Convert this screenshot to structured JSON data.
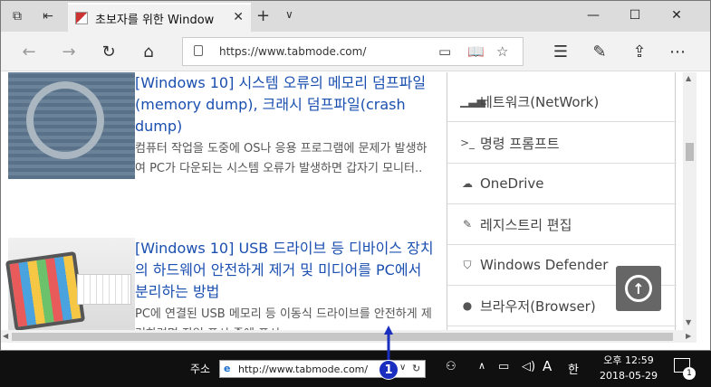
{
  "browser": {
    "tab_title": "초보자를 위한 Window",
    "url": "https://www.tabmode.com/"
  },
  "articles": [
    {
      "title": "[Windows 10] 시스템 오류의 메모리 덤프파일(memory dump), 크래시 덤프파일(crash dump)",
      "excerpt": "컴퓨터 작업을 도중에 OS나 응용 프로그램에 문제가 발생하여 PC가 다운되는 시스템 오류가 발생하면 갑자기 모니터.."
    },
    {
      "title": "[Windows 10] USB 드라이브 등 디바이스 장치의 하드웨어 안전하게 제거 및 미디어를 PC에서 분리하는 방법",
      "excerpt": "PC에 연결된 USB 메모리 등 이동식 드라이브를 안전하게 제거하려면 작업 표시 줄에 표시..."
    }
  ],
  "sidebar": {
    "items": [
      {
        "label": "네트워크(NetWork)",
        "icon": "signal-icon"
      },
      {
        "label": "명령 프롬프트",
        "icon": "terminal-icon"
      },
      {
        "label": "OneDrive",
        "icon": "cloud-icon"
      },
      {
        "label": "레지스트리 편집",
        "icon": "edit-icon"
      },
      {
        "label": "Windows Defender",
        "icon": "shield-icon"
      },
      {
        "label": "브라우저(Browser)",
        "icon": "globe-icon"
      }
    ]
  },
  "taskbar": {
    "address_label": "주소",
    "address_url": "http://www.tabmode.com/",
    "badge": "1",
    "ime_lang": "A",
    "ime_mode": "한",
    "time": "오후 12:59",
    "date": "2018-05-29",
    "notifications": "1"
  },
  "colors": {
    "link": "#1a4fb0",
    "taskbar": "#101010",
    "badge": "#1a2fc0"
  }
}
